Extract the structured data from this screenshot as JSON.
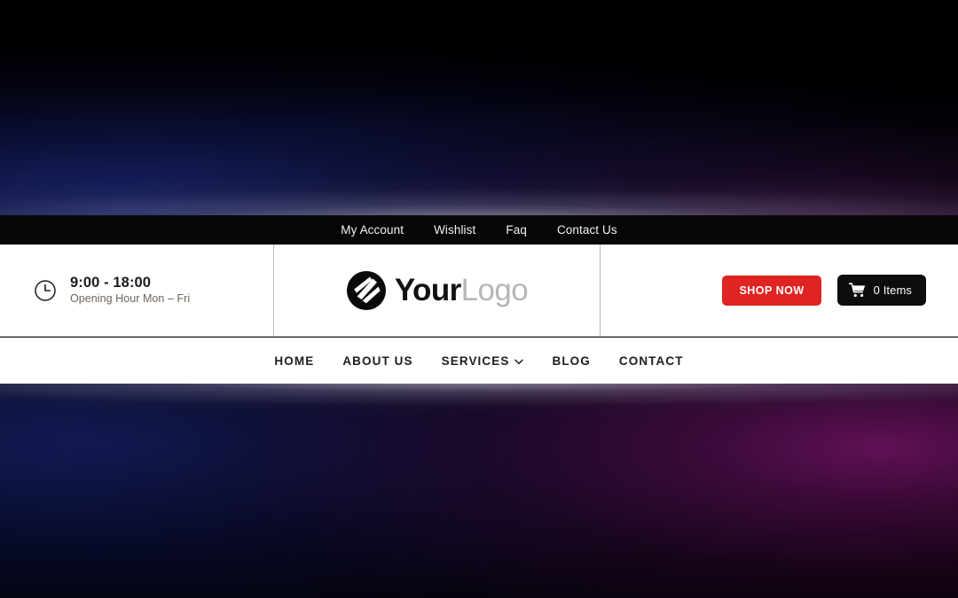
{
  "colors": {
    "accent_red": "#e02424",
    "cart_black": "#0d0d0d",
    "topbar_black": "#060606",
    "header_white": "#ffffff",
    "logo_gray": "#b6b6b6",
    "hours_sub": "#6d6458",
    "nav_text": "#1d1d22",
    "bg_navy": "#121a54",
    "bg_purple": "#68125c"
  },
  "topbar": {
    "links": [
      {
        "label": "My Account",
        "name": "topbar-link-my-account"
      },
      {
        "label": "Wishlist",
        "name": "topbar-link-wishlist"
      },
      {
        "label": "Faq",
        "name": "topbar-link-faq"
      },
      {
        "label": "Contact Us",
        "name": "topbar-link-contact-us"
      }
    ]
  },
  "header": {
    "hours": {
      "icon": "clock-icon",
      "time": "9:00 - 18:00",
      "caption": "Opening Hour Mon – Fri"
    },
    "logo": {
      "icon": "logo-swoosh-icon",
      "text_bold": "Your",
      "text_light": "Logo"
    },
    "shop_button": {
      "label": "SHOP NOW",
      "icon": ""
    },
    "cart_button": {
      "icon": "shopping-cart-icon",
      "label": "0 Items"
    }
  },
  "nav": {
    "items": [
      {
        "label": "HOME",
        "name": "nav-item-home",
        "has_dropdown": false
      },
      {
        "label": "ABOUT US",
        "name": "nav-item-about-us",
        "has_dropdown": false
      },
      {
        "label": "SERVICES",
        "name": "nav-item-services",
        "has_dropdown": true
      },
      {
        "label": "BLOG",
        "name": "nav-item-blog",
        "has_dropdown": false
      },
      {
        "label": "CONTACT",
        "name": "nav-item-contact",
        "has_dropdown": false
      }
    ]
  }
}
